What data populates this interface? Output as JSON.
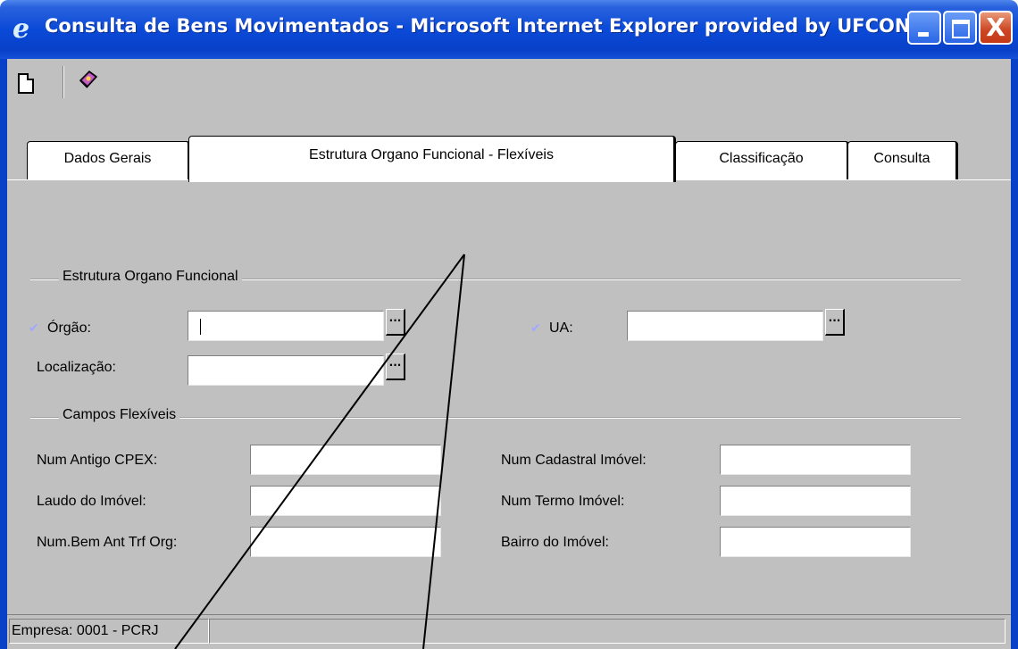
{
  "window": {
    "title": "Consulta de Bens Movimentados - Microsoft Internet Explorer provided by UFCON",
    "icon": "ie-logo-icon",
    "controls": [
      "minimize-icon",
      "maximize-icon",
      "close-icon"
    ],
    "close_glyph": "X"
  },
  "toolbar": {
    "icons": [
      "new-document-icon",
      "book-icon"
    ]
  },
  "tabs": [
    {
      "label": "Dados Gerais",
      "active": false
    },
    {
      "label": "Estrutura Organo Funcional - Flexíveis",
      "active": true
    },
    {
      "label": "Classificação",
      "active": false
    },
    {
      "label": "Consulta",
      "active": false
    }
  ],
  "estrutura": {
    "group_label": "Estrutura Organo Funcional",
    "orgao": {
      "label": "Órgão:",
      "value": ""
    },
    "ua": {
      "label": "UA:",
      "value": ""
    },
    "localizacao": {
      "label": "Localização:",
      "value": ""
    },
    "lookup_label": "...",
    "required_glyph": "✔"
  },
  "flexiveis": {
    "group_label": "Campos Flexíveis",
    "left": [
      {
        "label": "Num Antigo CPEX:",
        "value": ""
      },
      {
        "label": "Laudo do Imóvel:",
        "value": ""
      },
      {
        "label": "Num.Bem Ant Trf Org:",
        "value": ""
      }
    ],
    "right": [
      {
        "label": "Num Cadastral Imóvel:",
        "value": ""
      },
      {
        "label": "Num Termo Imóvel:",
        "value": ""
      },
      {
        "label": "Bairro do Imóvel:",
        "value": ""
      }
    ]
  },
  "status": {
    "empresa": "Empresa: 0001 - PCRJ"
  },
  "colors": {
    "titlebar": "#0a4ad8",
    "client": "#c0c0c0",
    "close_button": "#cc4422"
  }
}
